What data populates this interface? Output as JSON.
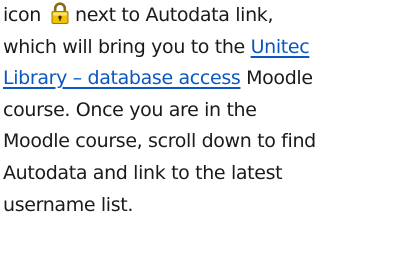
{
  "instructions": {
    "line1_pre_icon": "icon",
    "lock_icon": "lock-icon",
    "line1_post_icon": "next to Autodata link,",
    "line2_pre_link": "which will bring you to the ",
    "link_part1": "Unitec",
    "link_part2": "Library – database access",
    "line3_post_link": " Moodle",
    "line4": "course. Once you are in the",
    "line5": "Moodle course, scroll down to find",
    "line6": "Autodata and link to the latest",
    "line7": "username list."
  },
  "colors": {
    "text": "#1a1a1a",
    "link": "#0a57c2",
    "lock_body": "#f2c200",
    "lock_shackle": "#8a6a12"
  }
}
